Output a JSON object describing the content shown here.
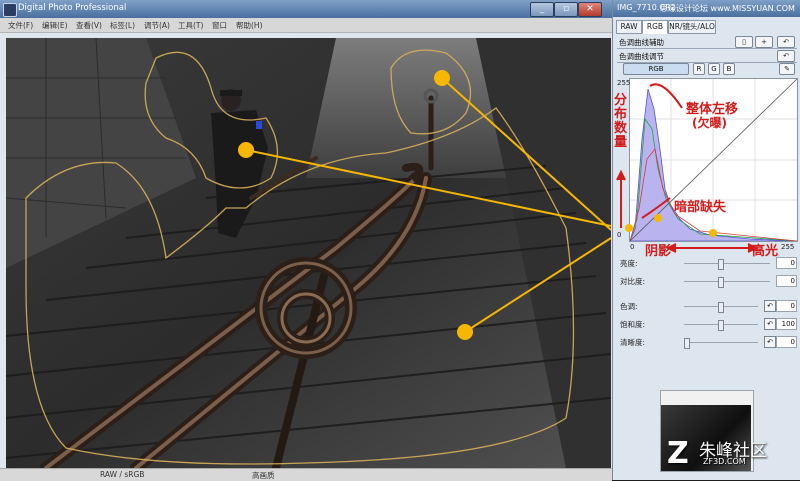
{
  "window": {
    "title": "Digital Photo Professional",
    "controls": [
      "_",
      "▫",
      "✕"
    ]
  },
  "menu": [
    "文件(F)",
    "编辑(E)",
    "查看(V)",
    "标签(L)",
    "调节(A)",
    "工具(T)",
    "窗口",
    "帮助(H)"
  ],
  "status": {
    "left": "RAW / sRGB",
    "right": "高画质"
  },
  "panel": {
    "title": "IMG_7710.CR2",
    "top_overlay": "思缘设计论坛  www.MISSYUAN.COM",
    "tabs": [
      "RAW",
      "RGB",
      "NR/镜头/ALO"
    ],
    "section1": "色调曲线辅助",
    "section2": "色调曲线调节",
    "channels": [
      "RGB",
      "R",
      "G",
      "B"
    ],
    "hist_axis": {
      "ymax": "255",
      "xmin": "0",
      "xmax": "255",
      "origin": "0"
    },
    "annotations": {
      "distribution": "分布数量",
      "shift": "整体左移",
      "underexposed": "(欠曝)",
      "shadow_loss": "暗部缺失",
      "shadow": "阴影",
      "highlight": "高光"
    },
    "sliders": [
      {
        "label": "亮度:",
        "value": "0",
        "level": 0.5,
        "reset": false
      },
      {
        "label": "对比度:",
        "value": "0",
        "level": 0.5,
        "reset": false
      },
      {
        "label": "色调:",
        "value": "0",
        "level": 0.5,
        "reset": true
      },
      {
        "label": "饱和度:",
        "value": "100",
        "level": 0.5,
        "reset": true
      },
      {
        "label": "清晰度:",
        "value": "0",
        "level": 0.0,
        "reset": true
      }
    ]
  },
  "watermark": {
    "name": "朱峰社区",
    "url": "ZF3D.COM"
  },
  "colors": {
    "accent_marker": "#f5b700",
    "annotation_red": "#d21b1b",
    "titlebar": "#4a6f9f"
  },
  "icons": [
    "app-icon",
    "minimize-icon",
    "maximize-icon",
    "close-icon",
    "undo-icon",
    "eyedropper-icon",
    "reset-icon"
  ]
}
